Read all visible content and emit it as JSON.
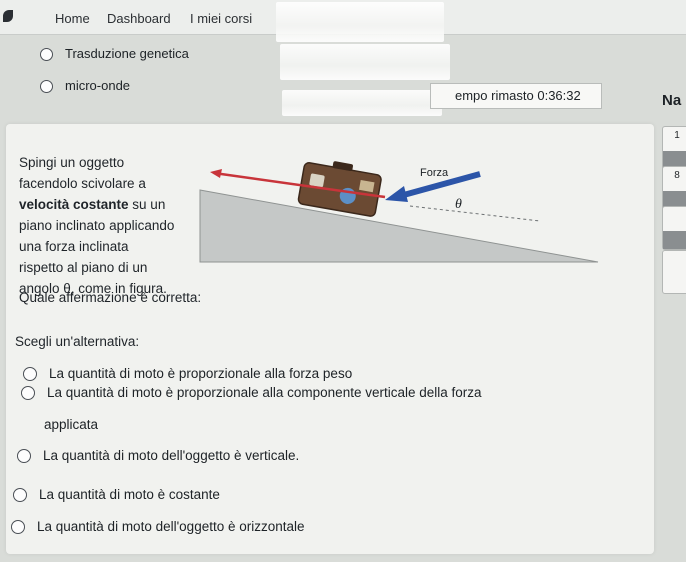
{
  "nav": {
    "links": [
      "Home",
      "Dashboard",
      "I miei corsi"
    ]
  },
  "previous_question": {
    "options": [
      "Trasduzione genetica",
      "micro-onde"
    ]
  },
  "timer": {
    "text": "empo rimasto 0:36:32"
  },
  "navigation": {
    "title": "Na",
    "boxes": [
      {
        "label": "1"
      },
      {
        "label": "8"
      }
    ]
  },
  "question": {
    "line1": "Spingi un oggetto",
    "line2": "facendolo scivolare a",
    "line3_bold": "velocità costante",
    "line3_rest": " su un",
    "line4": "piano inclinato applicando",
    "line5": "una forza inclinata",
    "line6": "rispetto al piano di un",
    "line7": "angolo θ, come in figura.",
    "prompt": "Quale affermazione è corretta:",
    "choose": "Scegli un'alternativa:",
    "answers": [
      "La quantità di moto è proporzionale alla forza peso",
      "La quantità di moto è proporzionale alla componente verticale della forza",
      "applicata",
      "La quantità di moto dell'oggetto è verticale.",
      "La quantità di moto è costante",
      "La quantità di moto dell'oggetto è orizzontale"
    ]
  },
  "figure": {
    "force_label": "Forza",
    "angle_label": "θ"
  },
  "colors": {
    "ramp": "#c5c8c7",
    "force_arrow": "#2c55a8",
    "friction_arrow": "#c8343a",
    "suitcase": "#6b4a33"
  }
}
